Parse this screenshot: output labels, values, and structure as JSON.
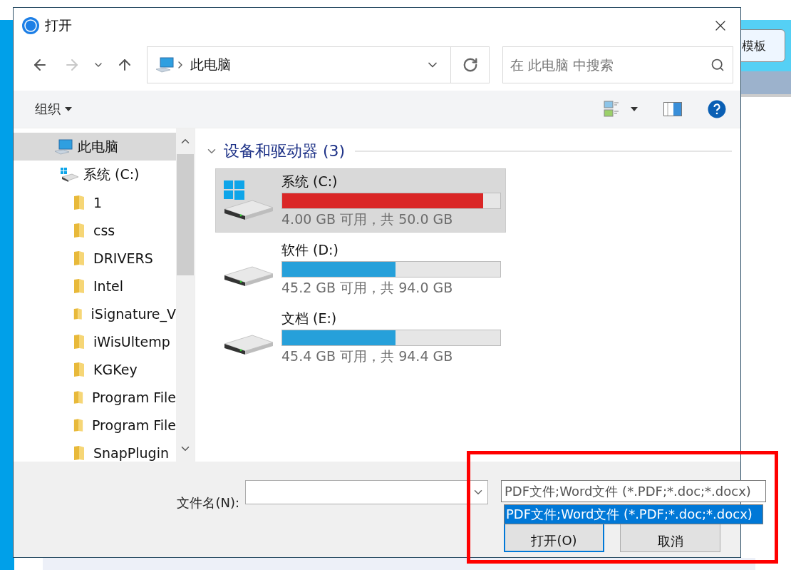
{
  "background_app": {
    "button": "模板"
  },
  "dialog": {
    "title": "打开",
    "nav_buttons": [
      {
        "kind": "back",
        "disabled": false
      },
      {
        "kind": "forward",
        "disabled": true
      },
      {
        "kind": "recent",
        "disabled": false
      },
      {
        "kind": "up",
        "disabled": false
      }
    ],
    "address": {
      "path": "此电脑"
    },
    "search": {
      "placeholder": "在 此电脑 中搜索"
    },
    "toolbar": {
      "organize": "组织"
    },
    "nav_tree": [
      {
        "label": "此电脑",
        "kind": "computer",
        "selected": true,
        "children": [
          {
            "label": "系统 (C:)",
            "kind": "drive",
            "selected": false,
            "children": [
              {
                "label": "1",
                "kind": "folder",
                "selected": false
              },
              {
                "label": "css",
                "kind": "folder",
                "selected": false
              },
              {
                "label": "DRIVERS",
                "kind": "folder",
                "selected": false
              },
              {
                "label": "Intel",
                "kind": "folder",
                "selected": false
              },
              {
                "label": "iSignature_V",
                "kind": "folder",
                "selected": false
              },
              {
                "label": "iWisUltemp",
                "kind": "folder",
                "selected": false
              },
              {
                "label": "KGKey",
                "kind": "folder",
                "selected": false
              },
              {
                "label": "Program File",
                "kind": "folder",
                "selected": false
              },
              {
                "label": "Program File",
                "kind": "folder",
                "selected": false
              },
              {
                "label": "SnapPlugin",
                "kind": "folder",
                "selected": false
              }
            ]
          }
        ]
      }
    ],
    "group": {
      "title": "设备和驱动器 (3)",
      "expanded": true
    },
    "drives": [
      {
        "name": "系统 (C:)",
        "kind": "system",
        "level": 0.92,
        "color": "#da2626",
        "info": "4.00 GB 可用，共 50.0 GB",
        "selected": true
      },
      {
        "name": "软件 (D:)",
        "kind": "data",
        "level": 0.52,
        "color": "#26a0da",
        "info": "45.2 GB 可用，共 94.0 GB",
        "selected": false
      },
      {
        "name": "文档 (E:)",
        "kind": "data",
        "level": 0.52,
        "color": "#26a0da",
        "info": "45.4 GB 可用，共 94.4 GB",
        "selected": false
      }
    ],
    "filename": {
      "label": "文件名(N):"
    },
    "filter": {
      "value": "PDF文件;Word文件 (*.PDF;*.doc;*.docx)",
      "expanded": true,
      "options": [
        {
          "label": "PDF文件;Word文件 (*.PDF;*.doc;*.docx)",
          "selected": true
        }
      ]
    },
    "buttons": [
      {
        "label": "打开(O)",
        "kind": "primary"
      },
      {
        "label": "取消",
        "kind": "normal"
      }
    ]
  }
}
